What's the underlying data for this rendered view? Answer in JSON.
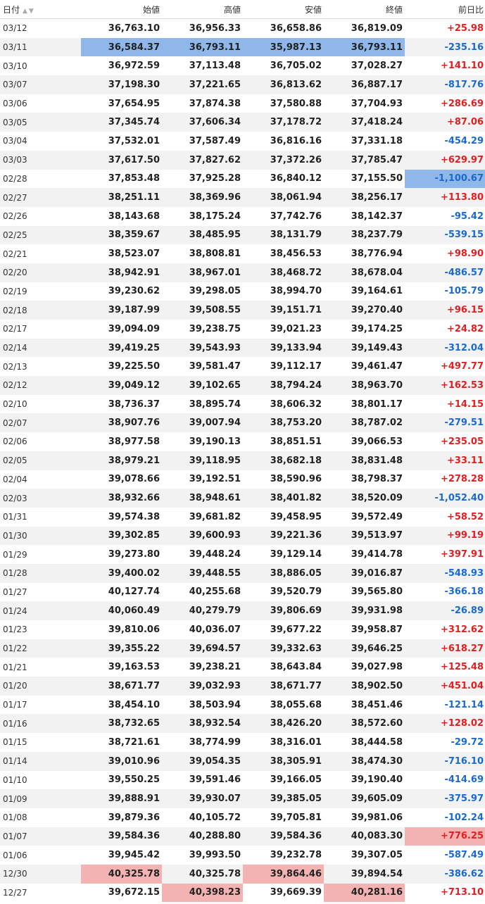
{
  "headers": {
    "date": "日付",
    "open": "始値",
    "high": "高値",
    "low": "安値",
    "close": "終値",
    "change": "前日比"
  },
  "colors": {
    "up": "#e02020",
    "down": "#1a6ad0",
    "highlight_low": "#8fb7ea",
    "highlight_high": "#f4b3b3"
  },
  "rows": [
    {
      "date": "03/12",
      "open": "36,763.10",
      "high": "36,956.33",
      "low": "36,658.86",
      "close": "36,819.09",
      "change": "+25.98",
      "dir": "up",
      "hl": {}
    },
    {
      "date": "03/11",
      "open": "36,584.37",
      "high": "36,793.11",
      "low": "35,987.13",
      "close": "36,793.11",
      "change": "-235.16",
      "dir": "down",
      "hl": {
        "open": "blue",
        "high": "blue",
        "low": "blue",
        "close": "blue"
      }
    },
    {
      "date": "03/10",
      "open": "36,972.59",
      "high": "37,113.48",
      "low": "36,705.02",
      "close": "37,028.27",
      "change": "+141.10",
      "dir": "up",
      "hl": {}
    },
    {
      "date": "03/07",
      "open": "37,198.30",
      "high": "37,221.65",
      "low": "36,813.62",
      "close": "36,887.17",
      "change": "-817.76",
      "dir": "down",
      "hl": {}
    },
    {
      "date": "03/06",
      "open": "37,654.95",
      "high": "37,874.38",
      "low": "37,580.88",
      "close": "37,704.93",
      "change": "+286.69",
      "dir": "up",
      "hl": {}
    },
    {
      "date": "03/05",
      "open": "37,345.74",
      "high": "37,606.34",
      "low": "37,178.72",
      "close": "37,418.24",
      "change": "+87.06",
      "dir": "up",
      "hl": {}
    },
    {
      "date": "03/04",
      "open": "37,532.01",
      "high": "37,587.49",
      "low": "36,816.16",
      "close": "37,331.18",
      "change": "-454.29",
      "dir": "down",
      "hl": {}
    },
    {
      "date": "03/03",
      "open": "37,617.50",
      "high": "37,827.62",
      "low": "37,372.26",
      "close": "37,785.47",
      "change": "+629.97",
      "dir": "up",
      "hl": {}
    },
    {
      "date": "02/28",
      "open": "37,853.48",
      "high": "37,925.28",
      "low": "36,840.12",
      "close": "37,155.50",
      "change": "-1,100.67",
      "dir": "down",
      "hl": {
        "change": "blue"
      }
    },
    {
      "date": "02/27",
      "open": "38,251.11",
      "high": "38,369.96",
      "low": "38,061.94",
      "close": "38,256.17",
      "change": "+113.80",
      "dir": "up",
      "hl": {}
    },
    {
      "date": "02/26",
      "open": "38,143.68",
      "high": "38,175.24",
      "low": "37,742.76",
      "close": "38,142.37",
      "change": "-95.42",
      "dir": "down",
      "hl": {}
    },
    {
      "date": "02/25",
      "open": "38,359.67",
      "high": "38,485.95",
      "low": "38,131.79",
      "close": "38,237.79",
      "change": "-539.15",
      "dir": "down",
      "hl": {}
    },
    {
      "date": "02/21",
      "open": "38,523.07",
      "high": "38,808.81",
      "low": "38,456.53",
      "close": "38,776.94",
      "change": "+98.90",
      "dir": "up",
      "hl": {}
    },
    {
      "date": "02/20",
      "open": "38,942.91",
      "high": "38,967.01",
      "low": "38,468.72",
      "close": "38,678.04",
      "change": "-486.57",
      "dir": "down",
      "hl": {}
    },
    {
      "date": "02/19",
      "open": "39,230.62",
      "high": "39,298.05",
      "low": "38,994.70",
      "close": "39,164.61",
      "change": "-105.79",
      "dir": "down",
      "hl": {}
    },
    {
      "date": "02/18",
      "open": "39,187.99",
      "high": "39,508.55",
      "low": "39,151.71",
      "close": "39,270.40",
      "change": "+96.15",
      "dir": "up",
      "hl": {}
    },
    {
      "date": "02/17",
      "open": "39,094.09",
      "high": "39,238.75",
      "low": "39,021.23",
      "close": "39,174.25",
      "change": "+24.82",
      "dir": "up",
      "hl": {}
    },
    {
      "date": "02/14",
      "open": "39,419.25",
      "high": "39,543.93",
      "low": "39,133.94",
      "close": "39,149.43",
      "change": "-312.04",
      "dir": "down",
      "hl": {}
    },
    {
      "date": "02/13",
      "open": "39,225.50",
      "high": "39,581.47",
      "low": "39,112.17",
      "close": "39,461.47",
      "change": "+497.77",
      "dir": "up",
      "hl": {}
    },
    {
      "date": "02/12",
      "open": "39,049.12",
      "high": "39,102.65",
      "low": "38,794.24",
      "close": "38,963.70",
      "change": "+162.53",
      "dir": "up",
      "hl": {}
    },
    {
      "date": "02/10",
      "open": "38,736.37",
      "high": "38,895.74",
      "low": "38,606.32",
      "close": "38,801.17",
      "change": "+14.15",
      "dir": "up",
      "hl": {}
    },
    {
      "date": "02/07",
      "open": "38,907.76",
      "high": "39,007.94",
      "low": "38,753.20",
      "close": "38,787.02",
      "change": "-279.51",
      "dir": "down",
      "hl": {}
    },
    {
      "date": "02/06",
      "open": "38,977.58",
      "high": "39,190.13",
      "low": "38,851.51",
      "close": "39,066.53",
      "change": "+235.05",
      "dir": "up",
      "hl": {}
    },
    {
      "date": "02/05",
      "open": "38,979.21",
      "high": "39,118.95",
      "low": "38,682.18",
      "close": "38,831.48",
      "change": "+33.11",
      "dir": "up",
      "hl": {}
    },
    {
      "date": "02/04",
      "open": "39,078.66",
      "high": "39,192.51",
      "low": "38,590.96",
      "close": "38,798.37",
      "change": "+278.28",
      "dir": "up",
      "hl": {}
    },
    {
      "date": "02/03",
      "open": "38,932.66",
      "high": "38,948.61",
      "low": "38,401.82",
      "close": "38,520.09",
      "change": "-1,052.40",
      "dir": "down",
      "hl": {}
    },
    {
      "date": "01/31",
      "open": "39,574.38",
      "high": "39,681.82",
      "low": "39,458.95",
      "close": "39,572.49",
      "change": "+58.52",
      "dir": "up",
      "hl": {}
    },
    {
      "date": "01/30",
      "open": "39,302.85",
      "high": "39,600.93",
      "low": "39,221.36",
      "close": "39,513.97",
      "change": "+99.19",
      "dir": "up",
      "hl": {}
    },
    {
      "date": "01/29",
      "open": "39,273.80",
      "high": "39,448.24",
      "low": "39,129.14",
      "close": "39,414.78",
      "change": "+397.91",
      "dir": "up",
      "hl": {}
    },
    {
      "date": "01/28",
      "open": "39,400.02",
      "high": "39,448.55",
      "low": "38,886.05",
      "close": "39,016.87",
      "change": "-548.93",
      "dir": "down",
      "hl": {}
    },
    {
      "date": "01/27",
      "open": "40,127.74",
      "high": "40,255.68",
      "low": "39,520.79",
      "close": "39,565.80",
      "change": "-366.18",
      "dir": "down",
      "hl": {}
    },
    {
      "date": "01/24",
      "open": "40,060.49",
      "high": "40,279.79",
      "low": "39,806.69",
      "close": "39,931.98",
      "change": "-26.89",
      "dir": "down",
      "hl": {}
    },
    {
      "date": "01/23",
      "open": "39,810.06",
      "high": "40,036.07",
      "low": "39,677.22",
      "close": "39,958.87",
      "change": "+312.62",
      "dir": "up",
      "hl": {}
    },
    {
      "date": "01/22",
      "open": "39,355.22",
      "high": "39,694.57",
      "low": "39,332.63",
      "close": "39,646.25",
      "change": "+618.27",
      "dir": "up",
      "hl": {}
    },
    {
      "date": "01/21",
      "open": "39,163.53",
      "high": "39,238.21",
      "low": "38,643.84",
      "close": "39,027.98",
      "change": "+125.48",
      "dir": "up",
      "hl": {}
    },
    {
      "date": "01/20",
      "open": "38,671.77",
      "high": "39,032.93",
      "low": "38,671.77",
      "close": "38,902.50",
      "change": "+451.04",
      "dir": "up",
      "hl": {}
    },
    {
      "date": "01/17",
      "open": "38,454.10",
      "high": "38,503.94",
      "low": "38,055.68",
      "close": "38,451.46",
      "change": "-121.14",
      "dir": "down",
      "hl": {}
    },
    {
      "date": "01/16",
      "open": "38,732.65",
      "high": "38,932.54",
      "low": "38,426.20",
      "close": "38,572.60",
      "change": "+128.02",
      "dir": "up",
      "hl": {}
    },
    {
      "date": "01/15",
      "open": "38,721.61",
      "high": "38,774.99",
      "low": "38,316.01",
      "close": "38,444.58",
      "change": "-29.72",
      "dir": "down",
      "hl": {}
    },
    {
      "date": "01/14",
      "open": "39,010.96",
      "high": "39,054.35",
      "low": "38,305.91",
      "close": "38,474.30",
      "change": "-716.10",
      "dir": "down",
      "hl": {}
    },
    {
      "date": "01/10",
      "open": "39,550.25",
      "high": "39,591.46",
      "low": "39,166.05",
      "close": "39,190.40",
      "change": "-414.69",
      "dir": "down",
      "hl": {}
    },
    {
      "date": "01/09",
      "open": "39,888.91",
      "high": "39,930.07",
      "low": "39,385.05",
      "close": "39,605.09",
      "change": "-375.97",
      "dir": "down",
      "hl": {}
    },
    {
      "date": "01/08",
      "open": "39,879.36",
      "high": "40,105.72",
      "low": "39,705.81",
      "close": "39,981.06",
      "change": "-102.24",
      "dir": "down",
      "hl": {}
    },
    {
      "date": "01/07",
      "open": "39,584.36",
      "high": "40,288.80",
      "low": "39,584.36",
      "close": "40,083.30",
      "change": "+776.25",
      "dir": "up",
      "hl": {
        "change": "red"
      }
    },
    {
      "date": "01/06",
      "open": "39,945.42",
      "high": "39,993.50",
      "low": "39,232.78",
      "close": "39,307.05",
      "change": "-587.49",
      "dir": "down",
      "hl": {}
    },
    {
      "date": "12/30",
      "open": "40,325.78",
      "high": "40,325.78",
      "low": "39,864.46",
      "close": "39,894.54",
      "change": "-386.62",
      "dir": "down",
      "hl": {
        "open": "red",
        "low": "red"
      }
    },
    {
      "date": "12/27",
      "open": "39,672.15",
      "high": "40,398.23",
      "low": "39,669.39",
      "close": "40,281.16",
      "change": "+713.10",
      "dir": "up",
      "hl": {
        "high": "red",
        "close": "red"
      }
    }
  ]
}
